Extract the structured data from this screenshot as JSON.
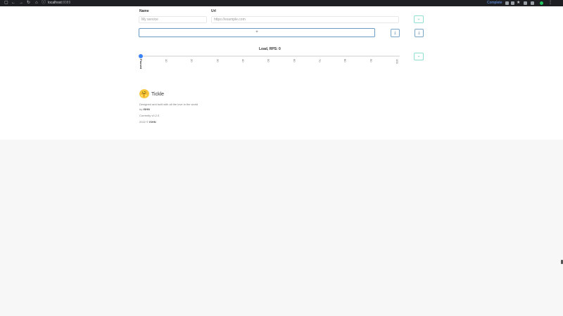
{
  "browser": {
    "url_host": "localhost",
    "url_port": ":8089",
    "right_label": "Complete",
    "icons": [
      "back-icon",
      "forward-icon",
      "reload-icon",
      "home-icon",
      "info-icon"
    ]
  },
  "form": {
    "name_label": "Name",
    "name_placeholder": "My service",
    "url_label": "Url",
    "url_placeholder": "https://example.com",
    "add_label": "+",
    "load_label": "Load, RPS: 0"
  },
  "slider": {
    "value": 0,
    "ticks": [
      "Paused",
      "10",
      "20",
      "30",
      "40",
      "50",
      "60",
      "70",
      "80",
      "90",
      "100"
    ]
  },
  "footer": {
    "logo_emoji": "🤗",
    "brand": "Tickle",
    "tagline": "Designed and built with all the love in the world",
    "by_prefix": "by",
    "by_name": "ISHN",
    "version": "Currently v0.2.0",
    "copyright_prefix": "2022 ©",
    "copyright_name": "ISHN"
  },
  "colors": {
    "accent_teal": "#5cc9b5",
    "accent_blue": "#3b82f6",
    "chrome_bg": "#1e1f22"
  }
}
